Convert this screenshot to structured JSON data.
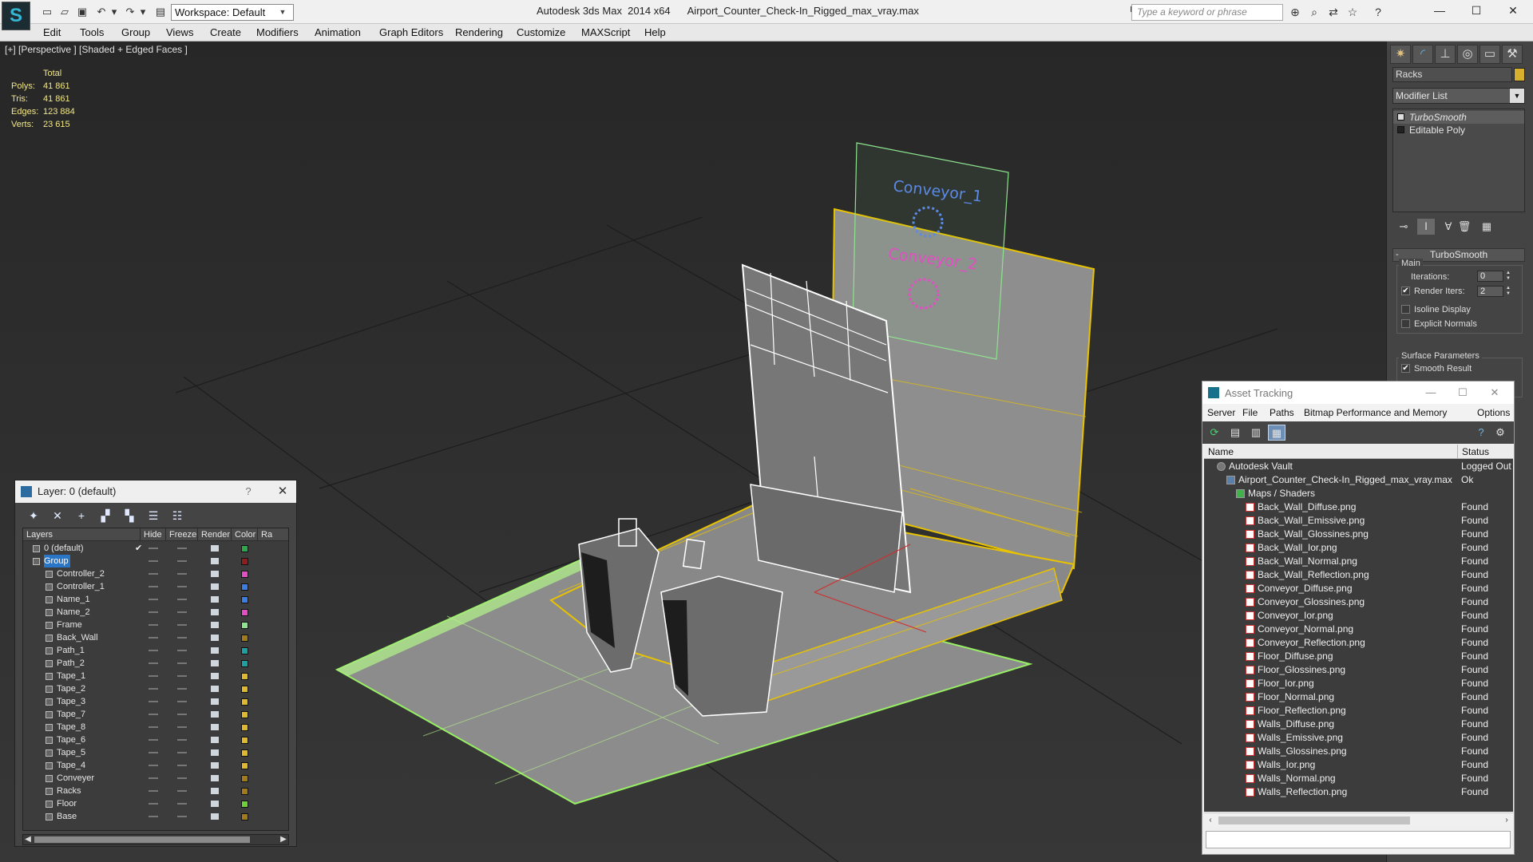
{
  "titlebar": {
    "workspace": "Workspace: Default",
    "app_name": "Autodesk 3ds Max  2014 x64",
    "file_name": "Airport_Counter_Check-In_Rigged_max_vray.max",
    "search_placeholder": "Type a keyword or phrase",
    "icons": [
      "new-file-icon",
      "open-file-icon",
      "save-icon",
      "undo-icon",
      "redo-icon",
      "project-folder-icon",
      "binoculars-icon",
      "search-tool-icon",
      "star-icon",
      "help-icon"
    ]
  },
  "menu": [
    "Edit",
    "Tools",
    "Group",
    "Views",
    "Create",
    "Modifiers",
    "Animation",
    "Graph Editors",
    "Rendering",
    "Customize",
    "MAXScript",
    "Help"
  ],
  "viewport": {
    "label": "[+] [Perspective ] [Shaded + Edged Faces ]",
    "stats_header": "Total",
    "stats": [
      {
        "label": "Polys:",
        "value": "41 861"
      },
      {
        "label": "Tris:",
        "value": "41 861"
      },
      {
        "label": "Edges:",
        "value": "123 884"
      },
      {
        "label": "Verts:",
        "value": "23 615"
      }
    ],
    "scene_labels": {
      "conveyor_1": "Conveyor_1",
      "conveyor_2": "Conveyor_2"
    },
    "colors": {
      "selection": "#e8c200",
      "floor_edge": "#98ef64",
      "wire": "#ffffff",
      "conveyor_1": "#5b8ae6",
      "conveyor_2": "#e24ec3",
      "helper": "#8ee28e"
    }
  },
  "command_panel": {
    "object_name": "Racks",
    "object_color": "#d8b030",
    "modifier_list": "Modifier List",
    "stack": [
      "TurboSmooth",
      "Editable Poly"
    ],
    "rollout_title": "TurboSmooth",
    "main_group": "Main",
    "iterations_label": "Iterations:",
    "iterations_value": "0",
    "render_iters_label": "Render Iters:",
    "render_iters_value": "2",
    "render_iters_checked": "✔",
    "isoline_label": "Isoline Display",
    "explicit_normals_label": "Explicit Normals",
    "surface_group": "Surface Parameters",
    "smooth_result_label": "Smooth Result",
    "smooth_result_checked": "✔"
  },
  "layer_dialog": {
    "title": "Layer: 0 (default)",
    "help": "?",
    "close": "✕",
    "columns": [
      "Layers",
      "Hide",
      "Freeze",
      "Render",
      "Color",
      "Ra"
    ],
    "rows": [
      {
        "name": "0 (default)",
        "color": "#2fa64a",
        "check": "✔",
        "selected": false,
        "level": 0
      },
      {
        "name": "Group",
        "color": "#8c1e1e",
        "check": "",
        "selected": true,
        "level": 0
      },
      {
        "name": "Controller_2",
        "color": "#e24ec3",
        "check": "",
        "selected": false,
        "level": 1
      },
      {
        "name": "Controller_1",
        "color": "#3c7de0",
        "check": "",
        "selected": false,
        "level": 1
      },
      {
        "name": "Name_1",
        "color": "#3c7de0",
        "check": "",
        "selected": false,
        "level": 1
      },
      {
        "name": "Name_2",
        "color": "#e24ec3",
        "check": "",
        "selected": false,
        "level": 1
      },
      {
        "name": "Frame",
        "color": "#8ee28e",
        "check": "",
        "selected": false,
        "level": 1
      },
      {
        "name": "Back_Wall",
        "color": "#a07a1c",
        "check": "",
        "selected": false,
        "level": 1
      },
      {
        "name": "Path_1",
        "color": "#1f9f9f",
        "check": "",
        "selected": false,
        "level": 1
      },
      {
        "name": "Path_2",
        "color": "#1f9f9f",
        "check": "",
        "selected": false,
        "level": 1
      },
      {
        "name": "Tape_1",
        "color": "#e0b830",
        "check": "",
        "selected": false,
        "level": 1
      },
      {
        "name": "Tape_2",
        "color": "#e0b830",
        "check": "",
        "selected": false,
        "level": 1
      },
      {
        "name": "Tape_3",
        "color": "#e0b830",
        "check": "",
        "selected": false,
        "level": 1
      },
      {
        "name": "Tape_7",
        "color": "#e0b830",
        "check": "",
        "selected": false,
        "level": 1
      },
      {
        "name": "Tape_8",
        "color": "#e0b830",
        "check": "",
        "selected": false,
        "level": 1
      },
      {
        "name": "Tape_6",
        "color": "#e0b830",
        "check": "",
        "selected": false,
        "level": 1
      },
      {
        "name": "Tape_5",
        "color": "#e0b830",
        "check": "",
        "selected": false,
        "level": 1
      },
      {
        "name": "Tape_4",
        "color": "#e0b830",
        "check": "",
        "selected": false,
        "level": 1
      },
      {
        "name": "Conveyer",
        "color": "#a07a1c",
        "check": "",
        "selected": false,
        "level": 1
      },
      {
        "name": "Racks",
        "color": "#a07a1c",
        "check": "",
        "selected": false,
        "level": 1
      },
      {
        "name": "Floor",
        "color": "#6fcf3a",
        "check": "",
        "selected": false,
        "level": 1
      },
      {
        "name": "Base",
        "color": "#a07a1c",
        "check": "",
        "selected": false,
        "level": 1
      }
    ]
  },
  "asset_tracking": {
    "title": "Asset Tracking",
    "menu": [
      "Server",
      "File",
      "Paths",
      "Bitmap Performance and Memory",
      "Options"
    ],
    "columns": [
      "Name",
      "Status"
    ],
    "rows": [
      {
        "name": "Autodesk Vault",
        "status": "Logged Out",
        "level": 1,
        "kind": "vault"
      },
      {
        "name": "Airport_Counter_Check-In_Rigged_max_vray.max",
        "status": "Ok",
        "level": 2,
        "kind": "max"
      },
      {
        "name": "Maps / Shaders",
        "status": "",
        "level": 3,
        "kind": "folder"
      },
      {
        "name": "Back_Wall_Diffuse.png",
        "status": "Found",
        "level": 4,
        "kind": "png"
      },
      {
        "name": "Back_Wall_Emissive.png",
        "status": "Found",
        "level": 4,
        "kind": "png"
      },
      {
        "name": "Back_Wall_Glossines.png",
        "status": "Found",
        "level": 4,
        "kind": "png"
      },
      {
        "name": "Back_Wall_Ior.png",
        "status": "Found",
        "level": 4,
        "kind": "png"
      },
      {
        "name": "Back_Wall_Normal.png",
        "status": "Found",
        "level": 4,
        "kind": "png"
      },
      {
        "name": "Back_Wall_Reflection.png",
        "status": "Found",
        "level": 4,
        "kind": "png"
      },
      {
        "name": "Conveyor_Diffuse.png",
        "status": "Found",
        "level": 4,
        "kind": "png"
      },
      {
        "name": "Conveyor_Glossines.png",
        "status": "Found",
        "level": 4,
        "kind": "png"
      },
      {
        "name": "Conveyor_Ior.png",
        "status": "Found",
        "level": 4,
        "kind": "png"
      },
      {
        "name": "Conveyor_Normal.png",
        "status": "Found",
        "level": 4,
        "kind": "png"
      },
      {
        "name": "Conveyor_Reflection.png",
        "status": "Found",
        "level": 4,
        "kind": "png"
      },
      {
        "name": "Floor_Diffuse.png",
        "status": "Found",
        "level": 4,
        "kind": "png"
      },
      {
        "name": "Floor_Glossines.png",
        "status": "Found",
        "level": 4,
        "kind": "png"
      },
      {
        "name": "Floor_Ior.png",
        "status": "Found",
        "level": 4,
        "kind": "png"
      },
      {
        "name": "Floor_Normal.png",
        "status": "Found",
        "level": 4,
        "kind": "png"
      },
      {
        "name": "Floor_Reflection.png",
        "status": "Found",
        "level": 4,
        "kind": "png"
      },
      {
        "name": "Walls_Diffuse.png",
        "status": "Found",
        "level": 4,
        "kind": "png"
      },
      {
        "name": "Walls_Emissive.png",
        "status": "Found",
        "level": 4,
        "kind": "png"
      },
      {
        "name": "Walls_Glossines.png",
        "status": "Found",
        "level": 4,
        "kind": "png"
      },
      {
        "name": "Walls_Ior.png",
        "status": "Found",
        "level": 4,
        "kind": "png"
      },
      {
        "name": "Walls_Normal.png",
        "status": "Found",
        "level": 4,
        "kind": "png"
      },
      {
        "name": "Walls_Reflection.png",
        "status": "Found",
        "level": 4,
        "kind": "png"
      }
    ]
  }
}
